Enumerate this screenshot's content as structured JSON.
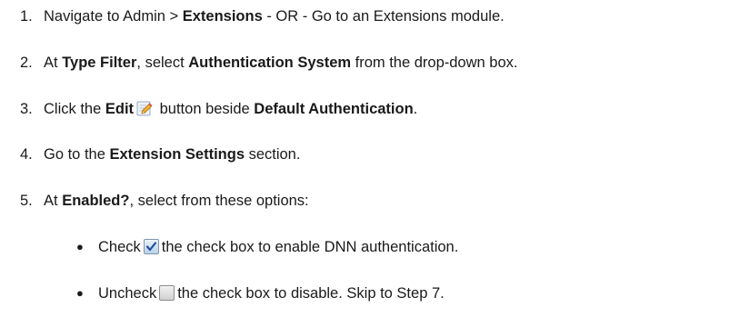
{
  "steps": [
    {
      "num": "1.",
      "t1": "Navigate to Admin > ",
      "b1": "Extensions",
      "t2": " - OR - Go to an Extensions module."
    },
    {
      "num": "2.",
      "t1": "At ",
      "b1": "Type Filter",
      "t2": ", select ",
      "b2": "Authentication System",
      "t3": " from the drop-down box."
    },
    {
      "num": "3.",
      "t1": "Click the ",
      "b1": "Edit",
      "icon": "edit-pencil-icon",
      "t2": " button beside ",
      "b2": "Default Authentication",
      "t3": "."
    },
    {
      "num": "4.",
      "t1": "Go to the ",
      "b1": "Extension Settings",
      "t2": " section."
    },
    {
      "num": "5.",
      "t1": "At ",
      "b1": "Enabled?",
      "t2": ", select from these options:"
    }
  ],
  "options": [
    {
      "t1": "Check",
      "icon": "checked-checkbox-icon",
      "t2": "the check box to enable DNN authentication."
    },
    {
      "t1": "Uncheck",
      "icon": "unchecked-checkbox-icon",
      "t2": "the check box to disable. Skip to Step 7."
    }
  ]
}
